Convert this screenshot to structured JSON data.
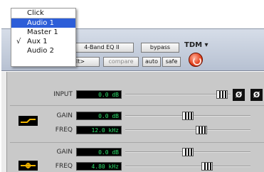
{
  "menu": {
    "items": [
      {
        "label": "Click",
        "selected": false,
        "checked": false
      },
      {
        "label": "Audio 1",
        "selected": true,
        "checked": false
      },
      {
        "label": "Master 1",
        "selected": false,
        "checked": false
      },
      {
        "label": "Aux 1",
        "selected": false,
        "checked": true
      },
      {
        "label": "Audio 2",
        "selected": false,
        "checked": false
      }
    ],
    "check_glyph": "√"
  },
  "header": {
    "plugin_name": "4-Band EQ II",
    "bypass_label": "bypass",
    "tdm_label": "TDM ▾",
    "preset_label": "ault>",
    "compare_label": "compare",
    "auto_label": "auto",
    "safe_label": "safe"
  },
  "controls": {
    "input": {
      "label": "INPUT",
      "value": "0.0 dB",
      "level": 0.97,
      "phase_glyph": "Ø"
    },
    "band1": {
      "gain": {
        "label": "GAIN",
        "value": "0.0 dB",
        "level": 0.5
      },
      "freq": {
        "label": "FREQ",
        "value": "12.0 kHz",
        "level": 0.62
      }
    },
    "band2": {
      "gain": {
        "label": "GAIN",
        "value": "0.0 dB",
        "level": 0.5
      },
      "freq": {
        "label": "FREQ",
        "value": "4.80 kHz",
        "level": 0.67
      }
    }
  },
  "colors": {
    "lcd_text": "#2de26d",
    "filter_icon": "#f0b400",
    "menu_highlight": "#2d5ed8"
  }
}
